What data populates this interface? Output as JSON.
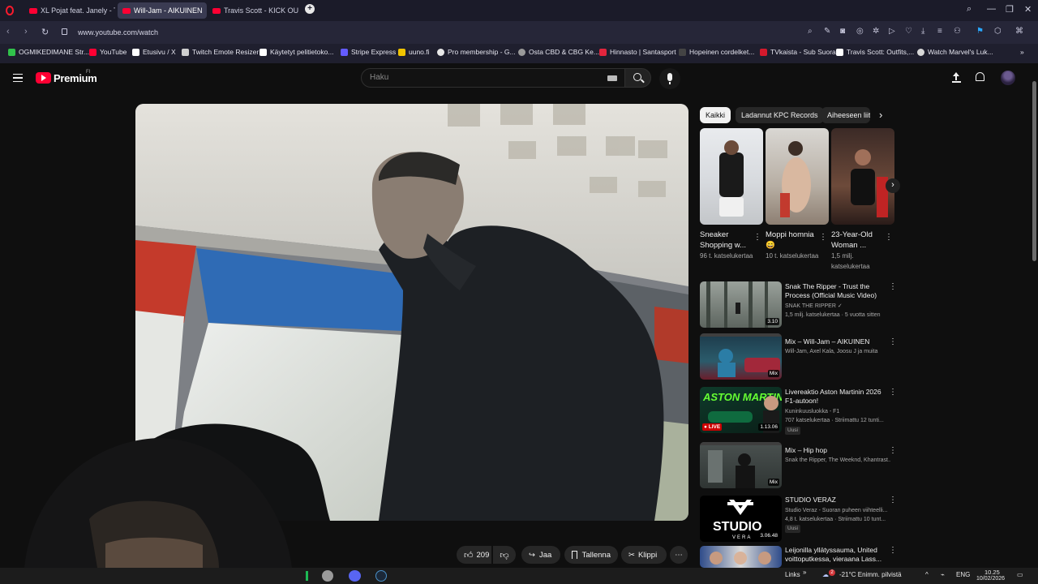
{
  "browser": {
    "tabs": [
      {
        "label": "XL Pojat feat. Janely - Tup"
      },
      {
        "label": "Will-Jam - AIKUINEN"
      },
      {
        "label": "Travis Scott - KICK OUT - Y"
      }
    ],
    "url": "www.youtube.com/watch",
    "bookmarks": [
      {
        "label": "OGMIKEDIMANE Str...",
        "color": "#31c24b"
      },
      {
        "label": "YouTube",
        "color": "#ff0033"
      },
      {
        "label": "Etusivu / X",
        "color": "#ffffff"
      },
      {
        "label": "Twitch Emote Resizer",
        "color": "#cfcfcf"
      },
      {
        "label": "Käytetyt pelitietoko...",
        "color": "#ffffff"
      },
      {
        "label": "Stripe Express",
        "color": "#635bff"
      },
      {
        "label": "uuno.fi",
        "color": "#f0c400"
      },
      {
        "label": "Pro membership - G...",
        "color": "#e8e8e8"
      },
      {
        "label": "Osta CBD & CBG Ke...",
        "color": "#9a9a9a"
      },
      {
        "label": "Hinnasto | Santasport",
        "color": "#e2253d"
      },
      {
        "label": "Hopeinen cordelket...",
        "color": "#222222"
      },
      {
        "label": "TVkaista - Sub Suora",
        "color": "#d4192c"
      },
      {
        "label": "Travis Scott: Outfits,...",
        "color": "#ffffff"
      },
      {
        "label": "Watch Marvel's Luk...",
        "color": "#d8d8d8"
      }
    ]
  },
  "youtube": {
    "logo_text": "Premium",
    "logo_country": "FI",
    "search_placeholder": "Haku"
  },
  "video_actions": {
    "likes": "209",
    "share": "Jaa",
    "save": "Tallenna",
    "clip": "Klippi"
  },
  "chips": [
    "Kaikki",
    "Ladannut KPC Records",
    "Aiheeseen liittyvät"
  ],
  "shorts": [
    {
      "title": "Sneaker Shopping w...",
      "views": "96 t. katselukertaa"
    },
    {
      "title": "Moppi homnia 😄",
      "views": "10 t. katselukertaa"
    },
    {
      "title": "23-Year-Old Woman ...",
      "views": "1,5 milj. katselukertaa"
    }
  ],
  "recommendations": [
    {
      "title": "Snak The Ripper - Trust the Process (Official Music Video)",
      "channel": "SNAK THE RIPPER ✓",
      "meta": "1,5 milj. katselukertaa · 5 vuotta sitten",
      "badge": "3.10",
      "uusi": ""
    },
    {
      "title": "Mix – Will-Jam – AIKUINEN",
      "channel": "Will-Jam, Axel Kala, Joosu J ja muita",
      "meta": "",
      "badge": "Mix",
      "uusi": ""
    },
    {
      "title": "Livereaktio Aston Martinin 2026 F1-autoon!",
      "channel": "Kuninkuusluokka - F1",
      "meta": "707 katselukertaa · Striimattu 12 tunti...",
      "badge": "1.13.06",
      "uusi": "Uusi"
    },
    {
      "title": "Mix – Hip hop",
      "channel": "Snak the Ripper, The Weeknd, Khantrast...",
      "meta": "",
      "badge": "Mix",
      "uusi": ""
    },
    {
      "title": "STUDIO VERAZ",
      "channel": "Studio Veraz - Suoran puheen viihteelli...",
      "meta": "4,8 t. katselukertaa · Striimattu 10 tunt...",
      "badge": "3.06.48",
      "uusi": "Uusi"
    },
    {
      "title": "Leijonilla yllätyssauma, United voittoputkessa, vieraana Lass...",
      "channel": "",
      "meta": "",
      "badge": "",
      "uusi": ""
    }
  ],
  "live_label": "LIVE",
  "thumb_texts": {
    "aston": "ASTON MARTIN",
    "studio": "STUDIO",
    "vera": "VERA"
  },
  "taskbar": {
    "links": "Links",
    "weather": "-21°C  Enimm. pilvistä",
    "lang": "ENG",
    "time": "10.25",
    "date": "10/02/2026",
    "notif": "2"
  },
  "colors": {
    "accent": "#ff0033",
    "bg": "#0f0f0f"
  }
}
